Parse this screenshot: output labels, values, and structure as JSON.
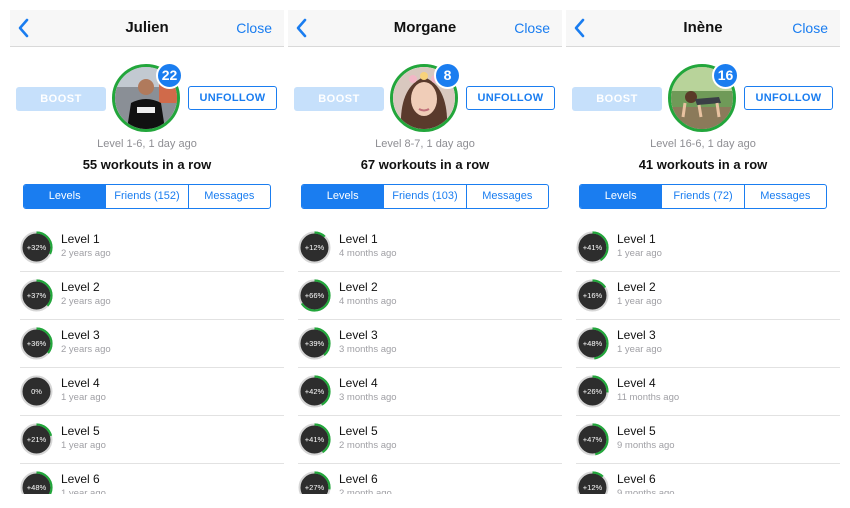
{
  "colors": {
    "accent": "#1a7df0",
    "ring_green": "#22a63b",
    "ring_bg": "#2d2d2d",
    "boost_disabled": "#c6e0fb"
  },
  "panels": [
    {
      "name": "Julien",
      "close_label": "Close",
      "boost_label": "BOOST",
      "unfollow_label": "UNFOLLOW",
      "badge": "22",
      "meta": "Level 1-6, 1 day ago",
      "streak": "55 workouts in a row",
      "tabs": [
        "Levels",
        "Friends (152)",
        "Messages"
      ],
      "levels": [
        {
          "label": "Level 1",
          "time": "2 years ago",
          "pct": "+32%",
          "progress": 0.32
        },
        {
          "label": "Level 2",
          "time": "2 years ago",
          "pct": "+37%",
          "progress": 0.37
        },
        {
          "label": "Level 3",
          "time": "2 years ago",
          "pct": "+36%",
          "progress": 0.36
        },
        {
          "label": "Level 4",
          "time": "1 year ago",
          "pct": "0%",
          "progress": 0.0
        },
        {
          "label": "Level 5",
          "time": "1 year ago",
          "pct": "+21%",
          "progress": 0.21
        },
        {
          "label": "Level 6",
          "time": "1 year ago",
          "pct": "+48%",
          "progress": 0.48
        }
      ]
    },
    {
      "name": "Morgane",
      "close_label": "Close",
      "boost_label": "BOOST",
      "unfollow_label": "UNFOLLOW",
      "badge": "8",
      "meta": "Level 8-7, 1 day ago",
      "streak": "67 workouts in a row",
      "tabs": [
        "Levels",
        "Friends (103)",
        "Messages"
      ],
      "levels": [
        {
          "label": "Level 1",
          "time": "4 months ago",
          "pct": "+12%",
          "progress": 0.12
        },
        {
          "label": "Level 2",
          "time": "4 months ago",
          "pct": "+66%",
          "progress": 0.66
        },
        {
          "label": "Level 3",
          "time": "3 months ago",
          "pct": "+39%",
          "progress": 0.39
        },
        {
          "label": "Level 4",
          "time": "3 months ago",
          "pct": "+42%",
          "progress": 0.42
        },
        {
          "label": "Level 5",
          "time": "2 months ago",
          "pct": "+41%",
          "progress": 0.41
        },
        {
          "label": "Level 6",
          "time": "2 month ago",
          "pct": "+27%",
          "progress": 0.27
        }
      ]
    },
    {
      "name": "Inène",
      "close_label": "Close",
      "boost_label": "BOOST",
      "unfollow_label": "UNFOLLOW",
      "badge": "16",
      "meta": "Level 16-6, 1 day ago",
      "streak": "41 workouts in a row",
      "tabs": [
        "Levels",
        "Friends (72)",
        "Messages"
      ],
      "levels": [
        {
          "label": "Level 1",
          "time": "1 year ago",
          "pct": "+41%",
          "progress": 0.41
        },
        {
          "label": "Level 2",
          "time": "1 year ago",
          "pct": "+16%",
          "progress": 0.16
        },
        {
          "label": "Level 3",
          "time": "1 year ago",
          "pct": "+48%",
          "progress": 0.48
        },
        {
          "label": "Level 4",
          "time": "11 months ago",
          "pct": "+26%",
          "progress": 0.26
        },
        {
          "label": "Level 5",
          "time": "9 months ago",
          "pct": "+47%",
          "progress": 0.47
        },
        {
          "label": "Level 6",
          "time": "9 months ago",
          "pct": "+12%",
          "progress": 0.12
        }
      ]
    }
  ]
}
